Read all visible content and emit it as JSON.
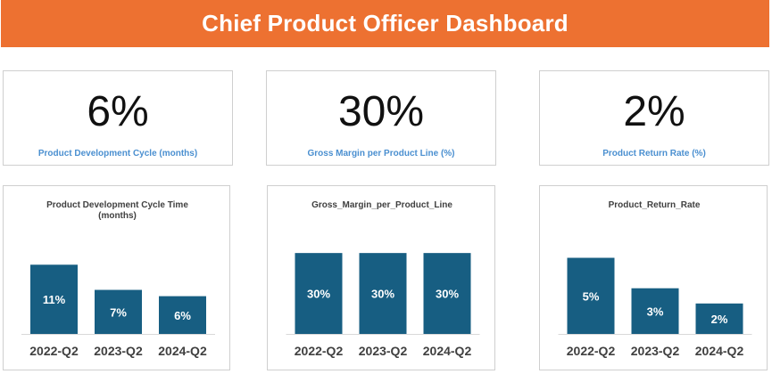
{
  "header": {
    "title": "Chief Product Officer Dashboard"
  },
  "kpis": [
    {
      "value": "6%",
      "label": "Product Development Cycle (months)"
    },
    {
      "value": "30%",
      "label": "Gross Margin per Product Line (%)"
    },
    {
      "value": "2%",
      "label": "Product Return Rate (%)"
    }
  ],
  "colors": {
    "header": "#ED7131",
    "bar": "#175E82",
    "kpi_label": "#4A8FD0"
  },
  "chart_data": [
    {
      "type": "bar",
      "title": [
        "Product Development Cycle Time",
        "(months)"
      ],
      "categories": [
        "2022-Q2",
        "2023-Q2",
        "2024-Q2"
      ],
      "values": [
        11,
        7,
        6
      ],
      "data_labels": [
        "11%",
        "7%",
        "6%"
      ],
      "ylim": [
        0,
        15
      ],
      "grid": false
    },
    {
      "type": "bar",
      "title": [
        "Gross_Margin_per_Product_Line"
      ],
      "categories": [
        "2022-Q2",
        "2023-Q2",
        "2024-Q2"
      ],
      "values": [
        30,
        30,
        30
      ],
      "data_labels": [
        "30%",
        "30%",
        "30%"
      ],
      "ylim": [
        0,
        35
      ],
      "grid": false
    },
    {
      "type": "bar",
      "title": [
        "Product_Return_Rate"
      ],
      "categories": [
        "2022-Q2",
        "2023-Q2",
        "2024-Q2"
      ],
      "values": [
        5,
        3,
        2
      ],
      "data_labels": [
        "5%",
        "3%",
        "2%"
      ],
      "ylim": [
        0,
        6.2
      ],
      "grid": false
    }
  ]
}
